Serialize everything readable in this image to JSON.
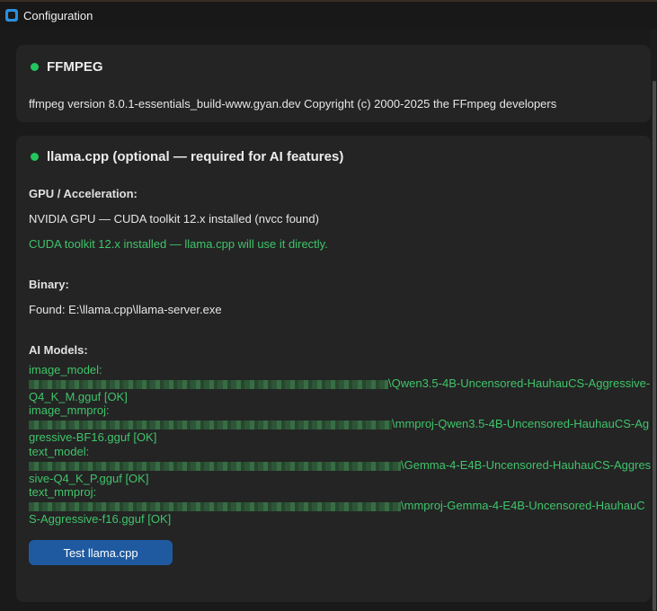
{
  "window": {
    "title": "Configuration",
    "icon": "app-icon"
  },
  "ffmpeg": {
    "title": "FFMPEG",
    "status_color": "#23c55e",
    "version_text": "ffmpeg version 8.0.1-essentials_build-www.gyan.dev Copyright (c) 2000-2025 the FFmpeg developers"
  },
  "llama": {
    "title": "llama.cpp  (optional — required for AI features)",
    "status_color": "#23c55e",
    "gpu_label": "GPU / Acceleration:",
    "gpu_text": "NVIDIA GPU — CUDA toolkit 12.x installed (nvcc found)",
    "cuda_text": "CUDA toolkit 12.x installed — llama.cpp will use it directly.",
    "binary_label": "Binary:",
    "binary_text": "Found: E:\\llama.cpp\\llama-server.exe",
    "models_label": "AI Models:",
    "models": [
      {
        "key": "image_model:",
        "line1": "\\Qwen3.5-4B-Uncensored-HauhauCS-Aggressive-",
        "line2": "Q4_K_M.gguf  [OK]"
      },
      {
        "key": "image_mmproj:",
        "line1": "\\mmproj-Qwen3.5-4B-Uncensored-HauhauCS-Ag",
        "line2": "gressive-BF16.gguf  [OK]"
      },
      {
        "key": "text_model:",
        "line1": "\\Gemma-4-E4B-Uncensored-HauhauCS-Aggres",
        "line2": "sive-Q4_K_P.gguf  [OK]"
      },
      {
        "key": "text_mmproj:",
        "line1": "\\mmproj-Gemma-4-E4B-Uncensored-HauhauC",
        "line2": "S-Aggressive-f16.gguf  [OK]"
      }
    ],
    "test_button": "Test llama.cpp"
  },
  "colors": {
    "accent_green": "#3fc46a",
    "button_blue": "#1f5aa0"
  }
}
